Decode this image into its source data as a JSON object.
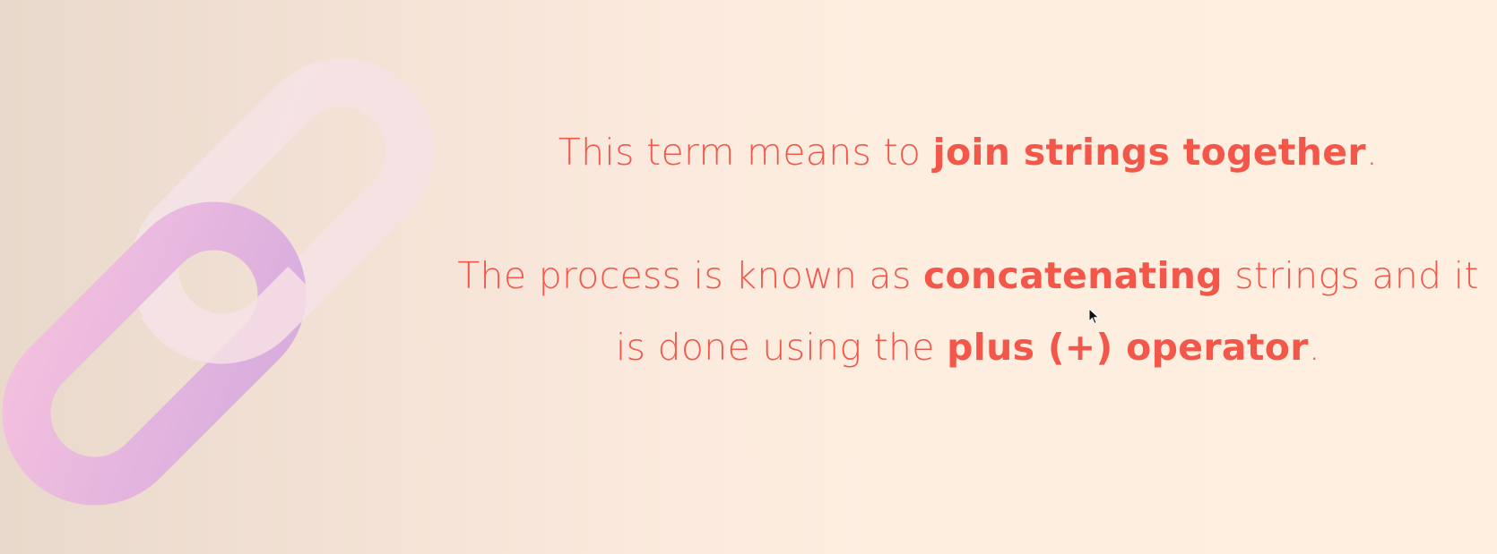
{
  "slide": {
    "definition": {
      "prefix": "This term means to ",
      "emphasis": "join strings together",
      "suffix": "."
    },
    "process": {
      "line1_prefix": "The process is known as ",
      "line1_emphasis": "concatenating",
      "line1_suffix": " strings and it",
      "line2_prefix": "is done using the ",
      "line2_emphasis": "plus (+) operator",
      "line2_suffix": "."
    },
    "icon": "chain-link-icon",
    "colors": {
      "text": "#f2574a",
      "link_front_start": "#f4bde0",
      "link_front_end": "#d8abdf",
      "link_back": "#f7e3e4",
      "background_left": "#e9d9cc",
      "background_right": "#feefe1"
    }
  }
}
